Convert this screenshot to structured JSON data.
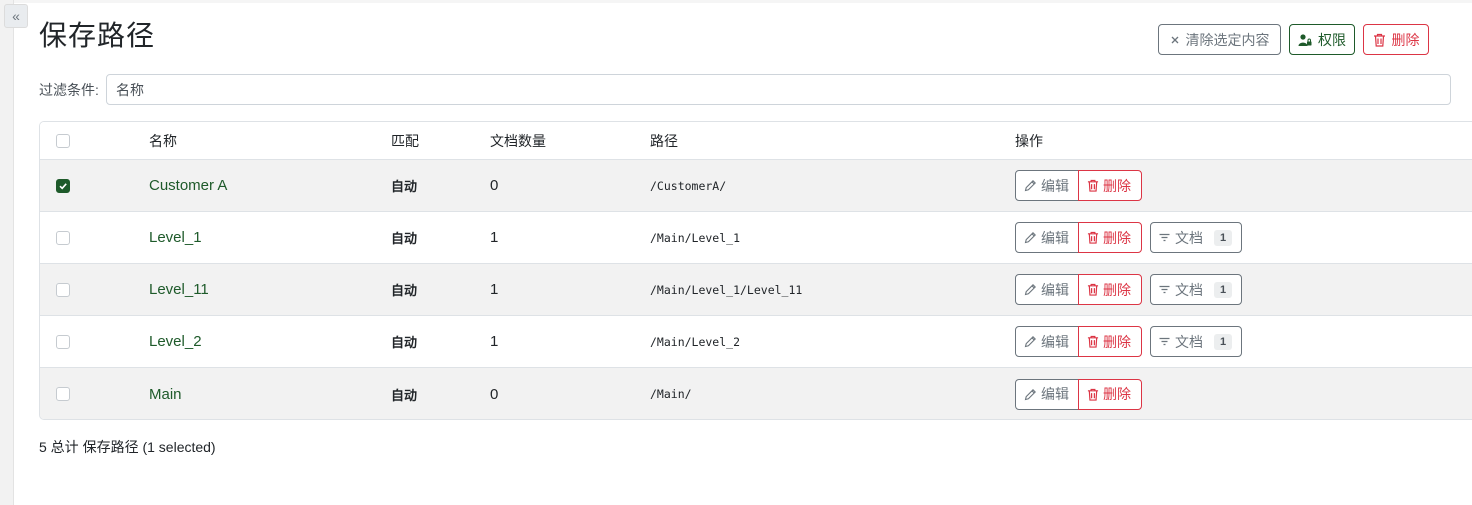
{
  "sidebar": {
    "collapse_glyph": "«"
  },
  "page": {
    "title": "保存路径"
  },
  "header_actions": {
    "clear_label": "清除选定内容",
    "permissions_label": "权限",
    "delete_label": "删除"
  },
  "filter": {
    "label": "过滤条件:",
    "placeholder": "名称",
    "value": ""
  },
  "table": {
    "columns": {
      "name": "名称",
      "match": "匹配",
      "documents": "文档数量",
      "path": "路径",
      "actions": "操作"
    },
    "rows": [
      {
        "checked": true,
        "name": "Customer A",
        "match": "自动",
        "document_count": "0",
        "path": "/CustomerA/",
        "has_documents_button": false
      },
      {
        "checked": false,
        "name": "Level_1",
        "match": "自动",
        "document_count": "1",
        "path": "/Main/Level_1",
        "has_documents_button": true
      },
      {
        "checked": false,
        "name": "Level_11",
        "match": "自动",
        "document_count": "1",
        "path": "/Main/Level_1/Level_11",
        "has_documents_button": true
      },
      {
        "checked": false,
        "name": "Level_2",
        "match": "自动",
        "document_count": "1",
        "path": "/Main/Level_2",
        "has_documents_button": true
      },
      {
        "checked": false,
        "name": "Main",
        "match": "自动",
        "document_count": "0",
        "path": "/Main/",
        "has_documents_button": false
      }
    ],
    "row_actions": {
      "edit_label": "编辑",
      "delete_label": "删除",
      "documents_label": "文档",
      "documents_badge": "1"
    }
  },
  "footer": {
    "summary": "5 总计 保存路径 (1 selected)"
  },
  "colors": {
    "primary": "#1e5a2a",
    "danger": "#dc3545",
    "secondary": "#6c757d",
    "stripe": "#f2f2f2"
  },
  "icons": {
    "collapse": "chevrons-left-icon",
    "clear": "x-icon",
    "permissions": "person-lock-icon",
    "delete": "trash-icon",
    "edit": "pencil-icon",
    "documents": "filter-icon",
    "check": "check-icon"
  }
}
